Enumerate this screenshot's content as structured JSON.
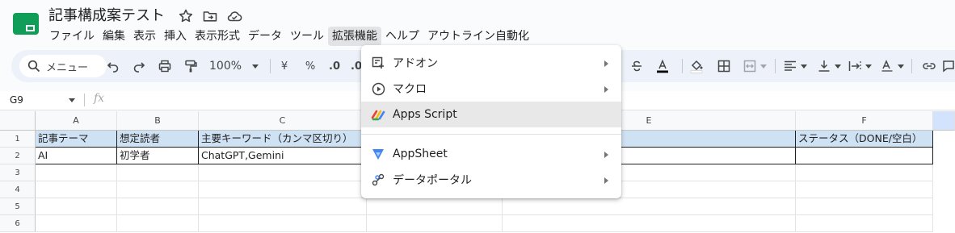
{
  "app": {
    "title": "記事構成案テスト",
    "brand_color": "#0f9d58",
    "accent_color": "#cfe2f3"
  },
  "title_icons": [
    "star-icon",
    "move-to-folder-icon",
    "cloud-status-icon"
  ],
  "menu": [
    {
      "label": "ファイル"
    },
    {
      "label": "編集"
    },
    {
      "label": "表示"
    },
    {
      "label": "挿入"
    },
    {
      "label": "表示形式"
    },
    {
      "label": "データ"
    },
    {
      "label": "ツール"
    },
    {
      "label": "拡張機能",
      "active": true
    },
    {
      "label": "ヘルプ"
    },
    {
      "label": "アウトライン自動化"
    }
  ],
  "toolbar": {
    "search_label": "メニュー",
    "zoom": "100%",
    "currency": "¥",
    "percent": "%",
    "decimal": ".0",
    "decimal2": ".0"
  },
  "formula_bar": {
    "cell_ref": "G9",
    "fx": "fx"
  },
  "grid": {
    "columns": [
      "A",
      "B",
      "C",
      "D",
      "E",
      "F"
    ],
    "rows": [
      "1",
      "2",
      "3",
      "4",
      "5",
      "6"
    ],
    "header_row": {
      "A": "記事テーマ",
      "B": "想定読者",
      "C": "主要キーワード（カンマ区切り）",
      "F": "ステータス（DONE/空白）"
    },
    "row2": {
      "A": "AI",
      "B": "初学者",
      "C": "ChatGPT,Gemini"
    }
  },
  "dropdown": {
    "items": [
      {
        "label": "アドオン",
        "icon": "addons-icon",
        "submenu": true
      },
      {
        "label": "マクロ",
        "icon": "macro-play-icon",
        "submenu": true
      },
      {
        "label": "Apps Script",
        "icon": "apps-script-icon",
        "submenu": false,
        "highlighted": true
      },
      {
        "label": "AppSheet",
        "icon": "appsheet-icon",
        "submenu": true
      },
      {
        "label": "データポータル",
        "icon": "data-portal-icon",
        "submenu": true
      }
    ]
  }
}
